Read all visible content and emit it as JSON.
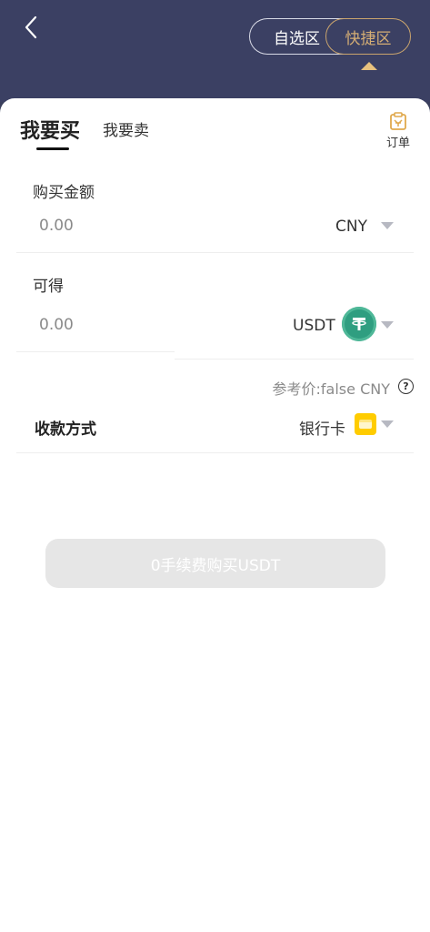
{
  "header": {
    "segments": [
      "自选区",
      "快捷区"
    ],
    "active_segment": "快捷区"
  },
  "tabs": {
    "buy": "我要买",
    "sell": "我要卖",
    "active": "我要买"
  },
  "order": {
    "label": "订单"
  },
  "buy_amount": {
    "label": "购买金额",
    "placeholder": "0.00",
    "currency": "CNY"
  },
  "receive": {
    "label": "可得",
    "placeholder": "0.00",
    "currency": "USDT"
  },
  "reference_price": "参考价:false CNY",
  "payment": {
    "label": "收款方式",
    "value": "银行卡"
  },
  "buy_button": "0手续费购买USDT",
  "colors": {
    "header_bg": "#3b4063",
    "accent": "#d4ad74",
    "usdt": "#2f9e80",
    "card": "#ffcc00"
  },
  "icons": {
    "back": "chevron-left-icon",
    "order": "clipboard-icon",
    "usdt": "tether-icon",
    "card": "bank-card-icon",
    "help": "question-circle-icon"
  }
}
